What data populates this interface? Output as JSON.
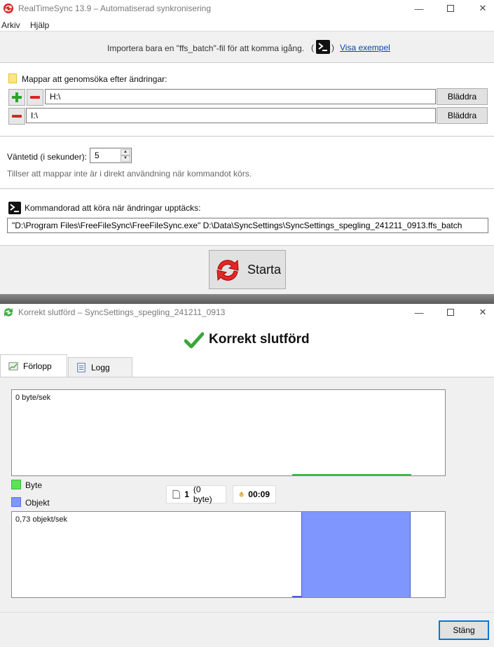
{
  "win1": {
    "title": "RealTimeSync 13.9 – Automatiserad synkronisering",
    "menu": [
      "Arkiv",
      "Hjälp"
    ],
    "hint_text": "Importera bara en \"ffs_batch\"-fil för att komma igång.",
    "hint_open_paren": "(",
    "hint_close_paren": ")",
    "hint_link": "Visa exempel",
    "folders_label": "Mappar att genomsöka efter ändringar:",
    "folders": [
      "H:\\",
      "I:\\"
    ],
    "browse_label": "Bläddra",
    "wait_label": "Väntetid (i sekunder):",
    "wait_value": "5",
    "wait_hint": "Tillser att mappar inte är i direkt användning när kommandot körs.",
    "cmd_label": "Kommandorad att köra när ändringar upptäcks:",
    "cmd_value": "\"D:\\Program Files\\FreeFileSync\\FreeFileSync.exe\" D:\\Data\\SyncSettings\\SyncSettings_spegling_241211_0913.ffs_batch",
    "start_label": "Starta"
  },
  "win2": {
    "title": "Korrekt slutförd – SyncSettings_spegling_241211_0913",
    "status": "Korrekt slutförd",
    "tabs": [
      "Förlopp",
      "Logg"
    ],
    "graph_bytes_label": "0 byte/sek",
    "graph_items_label": "0,73 objekt/sek",
    "legend": [
      {
        "label": "Byte",
        "color": "#5ee05e"
      },
      {
        "label": "Objekt",
        "color": "#8096ff"
      }
    ],
    "items_count": "1",
    "items_size": "(0 byte)",
    "elapsed": "00:09",
    "close_label": "Stäng"
  },
  "colors": {
    "bytes_line": "#3cb83c",
    "items_fill": "#8096ff",
    "link": "#0645ad",
    "focus": "#0078d7"
  }
}
